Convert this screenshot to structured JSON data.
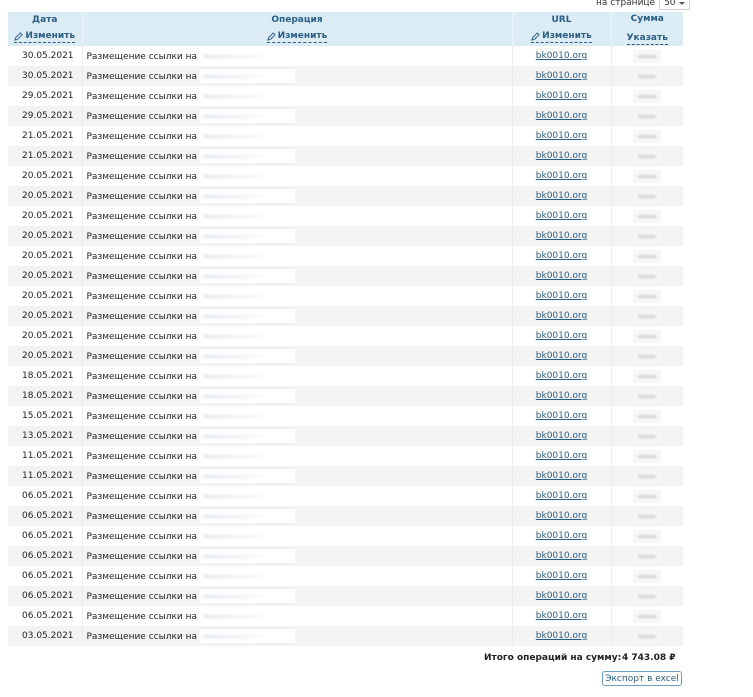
{
  "per_page": {
    "label": "на странице",
    "value": "50"
  },
  "columns": {
    "date": {
      "title": "Дата",
      "action": "Изменить"
    },
    "operation": {
      "title": "Операция",
      "action": "Изменить"
    },
    "url": {
      "title": "URL",
      "action": "Изменить"
    },
    "sum": {
      "title": "Сумма",
      "action": "Указать"
    }
  },
  "rows": [
    {
      "date": "30.05.2021",
      "operation": "Размещение ссылки на",
      "url": "bk0010.org"
    },
    {
      "date": "30.05.2021",
      "operation": "Размещение ссылки на",
      "url": "bk0010.org"
    },
    {
      "date": "29.05.2021",
      "operation": "Размещение ссылки на",
      "url": "bk0010.org"
    },
    {
      "date": "29.05.2021",
      "operation": "Размещение ссылки на",
      "url": "bk0010.org"
    },
    {
      "date": "21.05.2021",
      "operation": "Размещение ссылки на",
      "url": "bk0010.org"
    },
    {
      "date": "21.05.2021",
      "operation": "Размещение ссылки на",
      "url": "bk0010.org"
    },
    {
      "date": "20.05.2021",
      "operation": "Размещение ссылки на",
      "url": "bk0010.org"
    },
    {
      "date": "20.05.2021",
      "operation": "Размещение ссылки на",
      "url": "bk0010.org"
    },
    {
      "date": "20.05.2021",
      "operation": "Размещение ссылки на",
      "url": "bk0010.org"
    },
    {
      "date": "20.05.2021",
      "operation": "Размещение ссылки на",
      "url": "bk0010.org"
    },
    {
      "date": "20.05.2021",
      "operation": "Размещение ссылки на",
      "url": "bk0010.org"
    },
    {
      "date": "20.05.2021",
      "operation": "Размещение ссылки на",
      "url": "bk0010.org"
    },
    {
      "date": "20.05.2021",
      "operation": "Размещение ссылки на",
      "url": "bk0010.org"
    },
    {
      "date": "20.05.2021",
      "operation": "Размещение ссылки на",
      "url": "bk0010.org"
    },
    {
      "date": "20.05.2021",
      "operation": "Размещение ссылки на",
      "url": "bk0010.org"
    },
    {
      "date": "20.05.2021",
      "operation": "Размещение ссылки на",
      "url": "bk0010.org"
    },
    {
      "date": "18.05.2021",
      "operation": "Размещение ссылки на",
      "url": "bk0010.org"
    },
    {
      "date": "18.05.2021",
      "operation": "Размещение ссылки на",
      "url": "bk0010.org"
    },
    {
      "date": "15.05.2021",
      "operation": "Размещение ссылки на",
      "url": "bk0010.org"
    },
    {
      "date": "13.05.2021",
      "operation": "Размещение ссылки на",
      "url": "bk0010.org"
    },
    {
      "date": "11.05.2021",
      "operation": "Размещение ссылки на",
      "url": "bk0010.org"
    },
    {
      "date": "11.05.2021",
      "operation": "Размещение ссылки на",
      "url": "bk0010.org"
    },
    {
      "date": "06.05.2021",
      "operation": "Размещение ссылки на",
      "url": "bk0010.org"
    },
    {
      "date": "06.05.2021",
      "operation": "Размещение ссылки на",
      "url": "bk0010.org"
    },
    {
      "date": "06.05.2021",
      "operation": "Размещение ссылки на",
      "url": "bk0010.org"
    },
    {
      "date": "06.05.2021",
      "operation": "Размещение ссылки на",
      "url": "bk0010.org"
    },
    {
      "date": "06.05.2021",
      "operation": "Размещение ссылки на",
      "url": "bk0010.org"
    },
    {
      "date": "06.05.2021",
      "operation": "Размещение ссылки на",
      "url": "bk0010.org"
    },
    {
      "date": "06.05.2021",
      "operation": "Размещение ссылки на",
      "url": "bk0010.org"
    },
    {
      "date": "03.05.2021",
      "operation": "Размещение ссылки на",
      "url": "bk0010.org"
    }
  ],
  "total": {
    "label": "Итого операций на сумму:",
    "value": "4 743.08 ₽"
  },
  "export_button": "Экспорт в excel",
  "colors": {
    "header_bg": "#dcecf4",
    "link": "#2a5d84",
    "row_alt": "#f3f3f3"
  },
  "icons": {
    "edit": "pencil-icon",
    "dropdown": "chevron-down-icon"
  }
}
